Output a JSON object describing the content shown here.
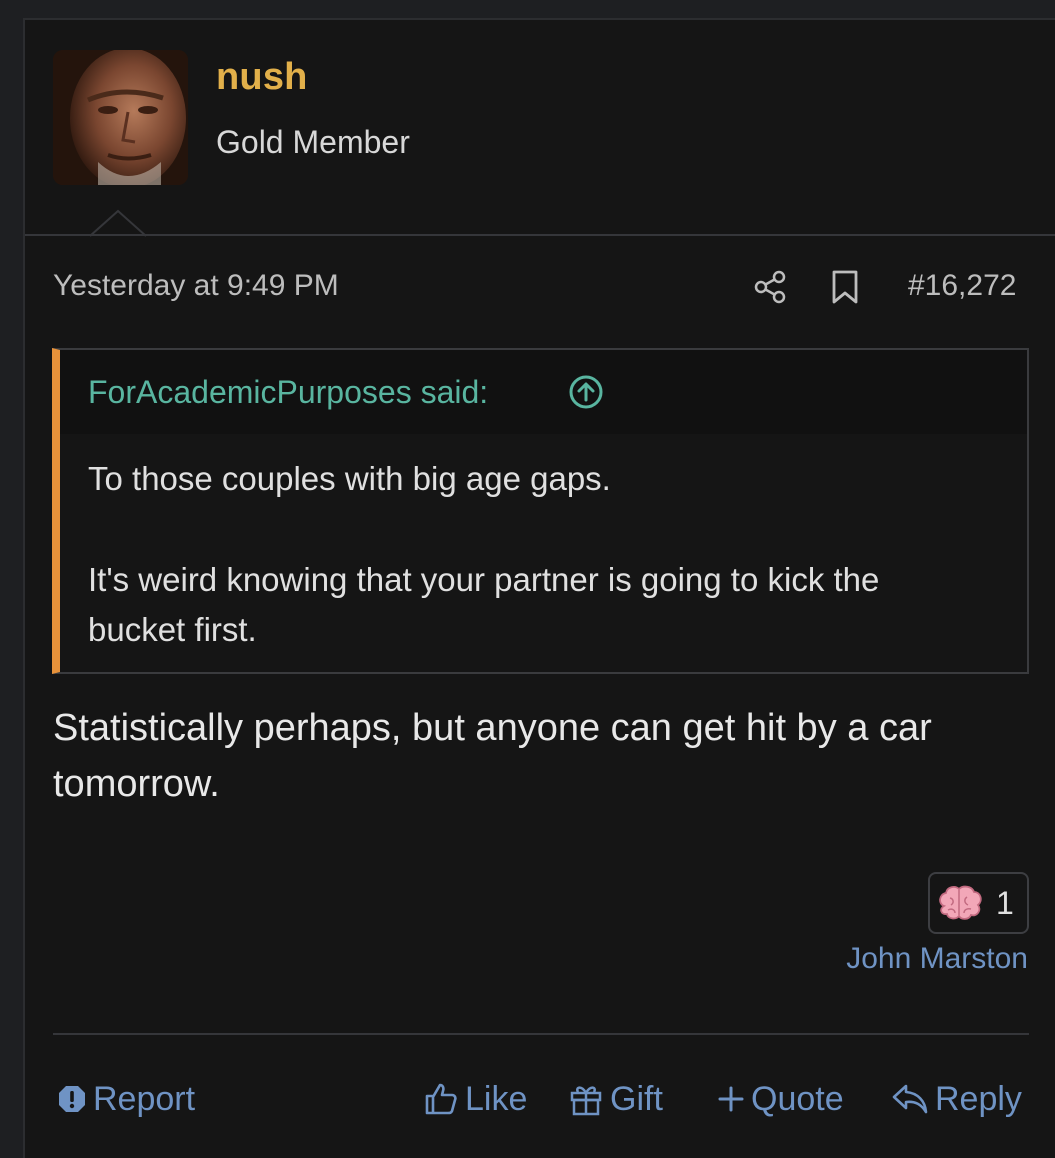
{
  "user": {
    "name": "nush",
    "title": "Gold Member",
    "avatar_icon": "avatar-photo"
  },
  "meta": {
    "timestamp": "Yesterday at 9:49 PM",
    "post_number": "#16,272",
    "share_icon": "share-icon",
    "bookmark_icon": "bookmark-icon"
  },
  "quote": {
    "author_label": "ForAcademicPurposes said:",
    "lines": [
      "To those couples with big age gaps.",
      "It's weird knowing that your partner is going to kick the",
      "bucket first."
    ]
  },
  "body": {
    "text": "Statistically perhaps, but anyone can get hit by a car tomorrow."
  },
  "reactions": {
    "icon": "brain-icon",
    "count": "1",
    "user": "John Marston"
  },
  "actions": {
    "report": "Report",
    "like": "Like",
    "gift": "Gift",
    "quote": "Quote",
    "reply": "Reply"
  },
  "colors": {
    "background": "#151515",
    "username": "#e2b04a",
    "link": "#6f93c4",
    "quote_author": "#59b5a0",
    "quote_border": "#e8923a"
  }
}
